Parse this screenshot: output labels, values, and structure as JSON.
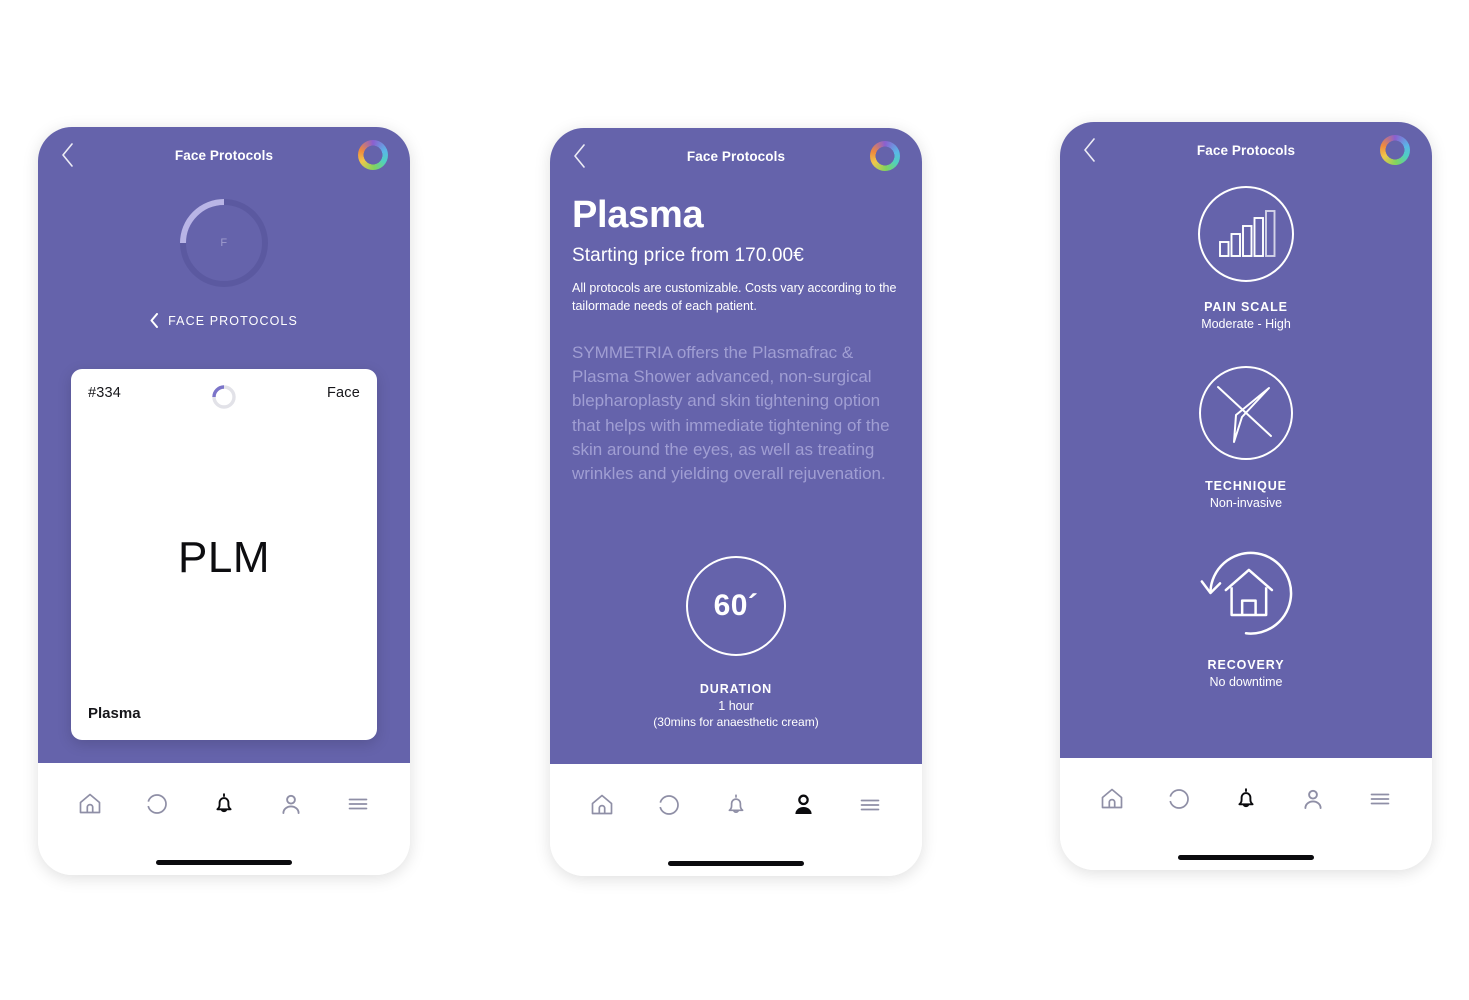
{
  "theme": {
    "screen_bg": "#6563ab",
    "card_bg": "#ffffff",
    "accent_light": "#a09ed3",
    "ring_progress": "#b9b5e6",
    "nav_inactive": "#8f8fa6",
    "nav_active": "#0b0b0e"
  },
  "header": {
    "title": "Face Protocols",
    "back_icon": "chevron-left-icon",
    "brand_icon": "brand-ring-icon"
  },
  "nav": {
    "items": [
      {
        "label": "Home",
        "icon": "home-icon",
        "active": false
      },
      {
        "label": "Protocols",
        "icon": "dashed-circle-icon",
        "active": false
      },
      {
        "label": "Notifications",
        "icon": "bell-icon",
        "active": true
      },
      {
        "label": "Profile",
        "icon": "person-icon",
        "active": false
      },
      {
        "label": "Menu",
        "icon": "hamburger-menu-icon",
        "active": false
      }
    ],
    "nav_active_screen1": "Notifications",
    "nav_active_screen2": "Profile",
    "nav_active_screen3": "Notifications"
  },
  "screen1": {
    "ring_letter": "F",
    "ring_progress_pct": 25,
    "section_link": "FACE PROTOCOLS",
    "section_link_icon": "chevron-left-icon",
    "card": {
      "id": "#334",
      "category": "Face",
      "code": "PLM",
      "name": "Plasma",
      "mini_ring_icon": "progress-ring-icon",
      "mini_ring_pct": 22
    }
  },
  "screen2": {
    "title": "Plasma",
    "price": "Starting price from 170.00€",
    "note": "All protocols are customizable. Costs vary according to the tailormade needs of each patient.",
    "description": "SYMMETRIA offers the Plasmafrac & Plasma Shower advanced, non-surgical blepharoplasty and skin tightening option that helps with immediate tightening of the skin around the eyes, as well as treating wrinkles and yielding overall rejuvenation.",
    "duration": {
      "circle_value": "60´",
      "label": "DURATION",
      "value": "1 hour",
      "sub": "(30mins for anaesthetic cream)"
    }
  },
  "screen3": {
    "items": [
      {
        "icon": "bar-chart-icon",
        "title": "PAIN SCALE",
        "value": "Moderate - High"
      },
      {
        "icon": "no-needle-icon",
        "title": "TECHNIQUE",
        "value": "Non-invasive"
      },
      {
        "icon": "house-refresh-icon",
        "title": "RECOVERY",
        "value": "No downtime"
      }
    ]
  }
}
